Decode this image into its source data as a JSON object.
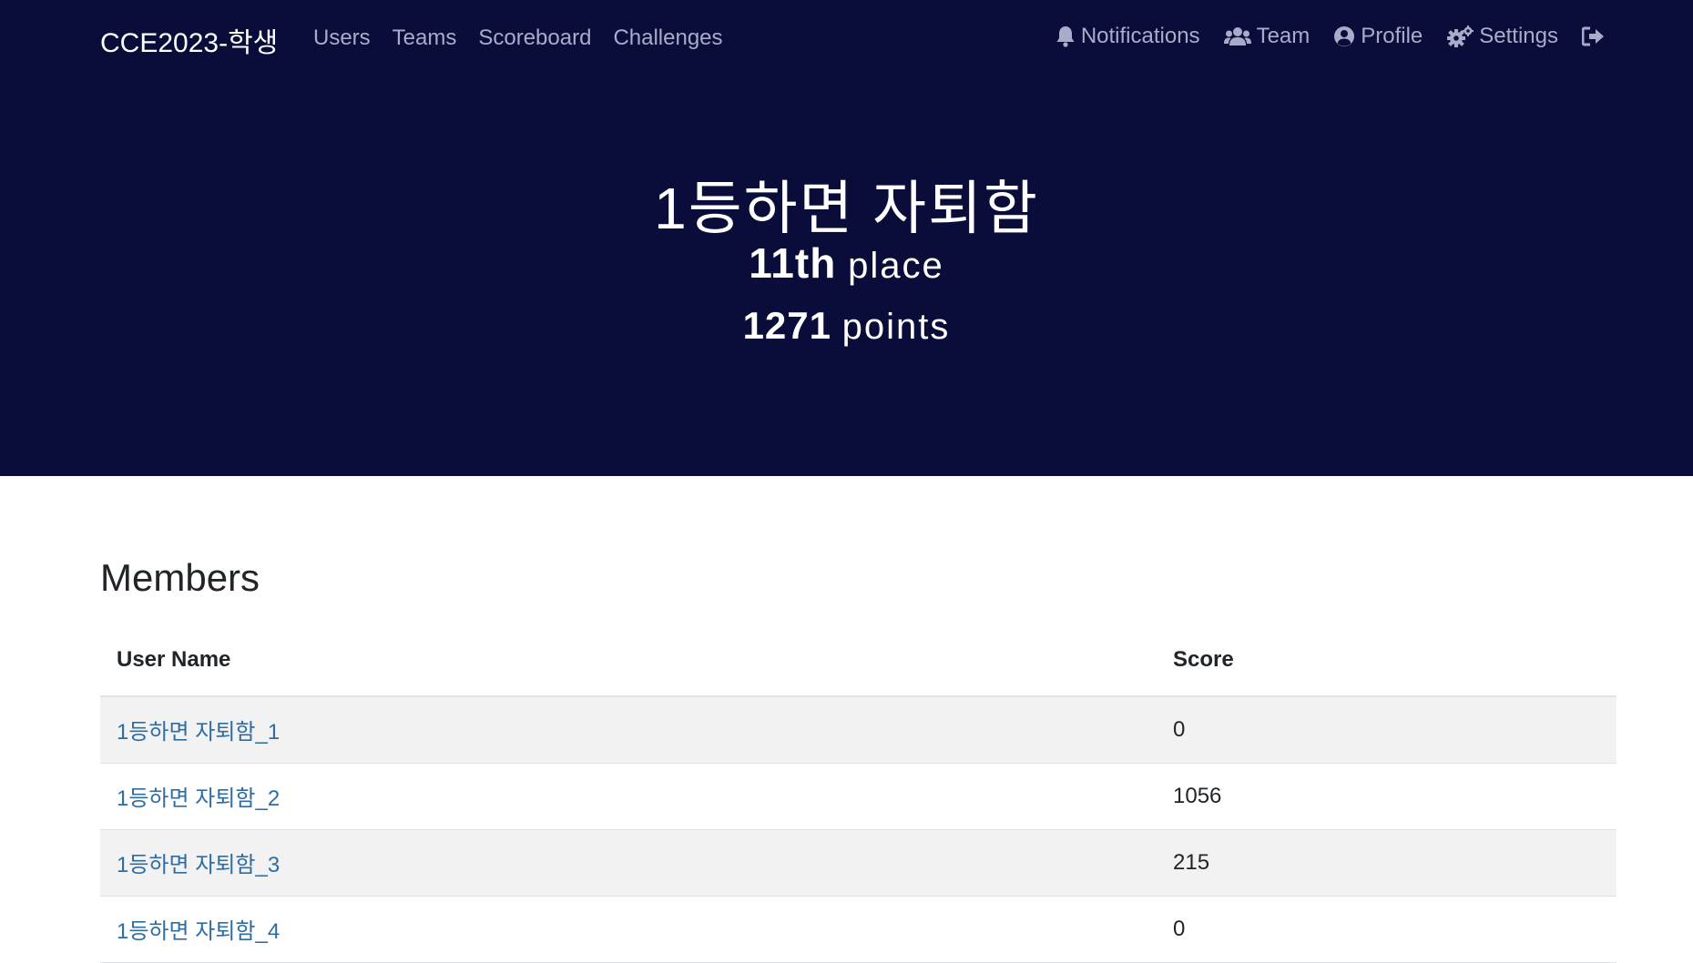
{
  "nav": {
    "brand": "CCE2023-학생",
    "links": [
      "Users",
      "Teams",
      "Scoreboard",
      "Challenges"
    ],
    "right": {
      "notifications": "Notifications",
      "team": "Team",
      "profile": "Profile",
      "settings": "Settings"
    }
  },
  "hero": {
    "team_name": "1등하면 자퇴함",
    "place_value": "11th",
    "place_label": "place",
    "points_value": "1271",
    "points_label": "points"
  },
  "members": {
    "title": "Members",
    "columns": [
      "User Name",
      "Score"
    ],
    "rows": [
      {
        "name": "1등하면 자퇴함_1",
        "score": "0"
      },
      {
        "name": "1등하면 자퇴함_2",
        "score": "1056"
      },
      {
        "name": "1등하면 자퇴함_3",
        "score": "215"
      },
      {
        "name": "1등하면 자퇴함_4",
        "score": "0"
      }
    ]
  },
  "colors": {
    "header_bg": "#0a0d3a",
    "nav_text": "#a8acc8",
    "link": "#2e6da4",
    "row_stripe": "#f2f2f2"
  }
}
